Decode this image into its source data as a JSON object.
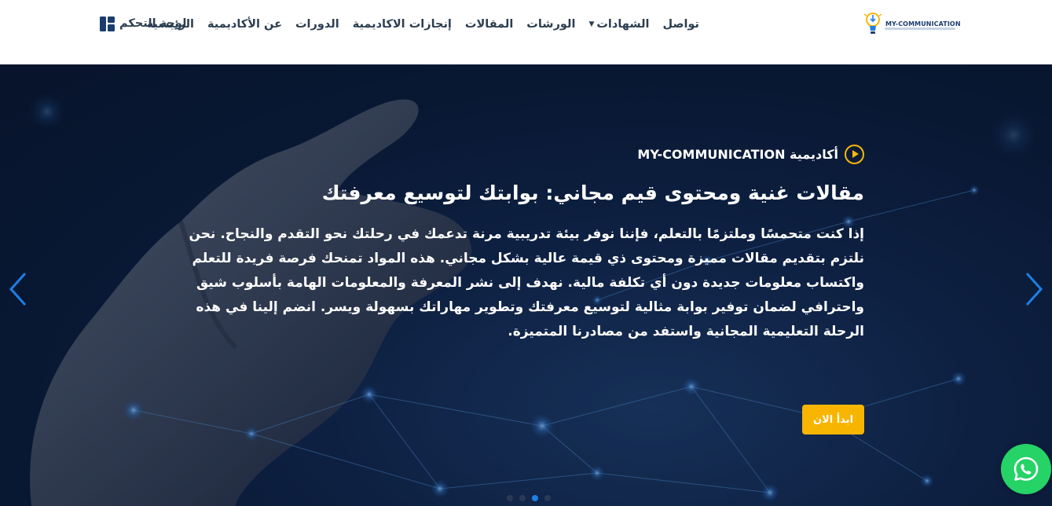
{
  "header": {
    "logo_text": "MY-COMMUNICATION",
    "nav_items": [
      {
        "label": "الرئيسية"
      },
      {
        "label": "عن الأكاديمية"
      },
      {
        "label": "الدورات"
      },
      {
        "label": "إنجازات الاكاديمية"
      },
      {
        "label": "المقالات"
      },
      {
        "label": "الورشات"
      },
      {
        "label": "الشهادات",
        "has_dropdown": true
      },
      {
        "label": "تواصل"
      }
    ],
    "dashboard_label": "لوحة التحكم",
    "dashboard_icon": "dashboard-icon"
  },
  "hero": {
    "subtitle": "أكاديمية MY-COMMUNICATION",
    "title": "مقالات غنية ومحتوى قيم مجاني: بوابتك لتوسيع معرفتك",
    "description": "إذا كنت متحمسًا وملتزمًا بالتعلم، فإننا نوفر بيئة تدريبية مرنة تدعمك في رحلتك نحو التقدم والنجاح. نحن نلتزم بتقديم مقالات مميزة ومحتوى ذي قيمة عالية بشكل مجاني. هذه المواد تمنحك فرصة فريدة للتعلم واكتساب معلومات جديدة دون أي تكلفة مالية. نهدف إلى نشر المعرفة والمعلومات الهامة بأسلوب شيق واحترافي لضمان توفير بوابة مثالية لتوسيع معرفتك وتطوير مهاراتك بسهولة ويسر. انضم إلينا في هذه الرحلة التعليمية المجانية واستفد من مصادرنا المتميزة.",
    "cta_label": "ابدأ الان",
    "slides_count": 4,
    "active_slide": 3
  },
  "icons": {
    "play": "play-circle-icon",
    "prev": "chevron-left-icon",
    "next": "chevron-right-icon",
    "whatsapp": "whatsapp-icon"
  },
  "colors": {
    "accent": "#f7b500",
    "nav_text": "#2c3e50",
    "arrow": "#1e7fe6",
    "whatsapp": "#25d366",
    "hero_bg": "#0a1a36"
  }
}
